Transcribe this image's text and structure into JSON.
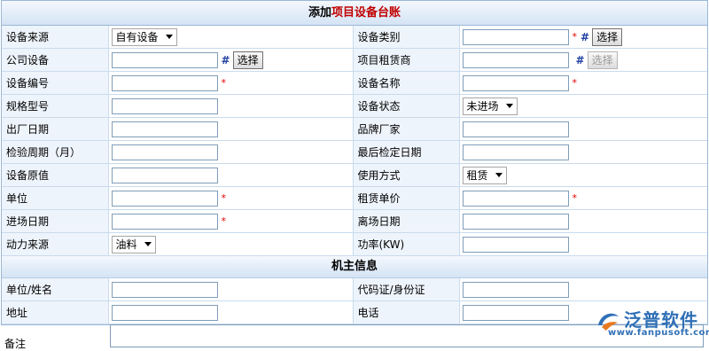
{
  "title": {
    "prefix": "添加",
    "highlight": "项目设备台账"
  },
  "rows": [
    {
      "l_label": "设备来源",
      "r_label": "设备类别"
    },
    {
      "l_label": "公司设备",
      "r_label": "项目租赁商"
    },
    {
      "l_label": "设备编号",
      "r_label": "设备名称"
    },
    {
      "l_label": "规格型号",
      "r_label": "设备状态"
    },
    {
      "l_label": "出厂日期",
      "r_label": "品牌厂家"
    },
    {
      "l_label": "检验周期（月）",
      "r_label": "最后检定日期"
    },
    {
      "l_label": "设备原值",
      "r_label": "使用方式"
    },
    {
      "l_label": "单位",
      "r_label": "租赁单价"
    },
    {
      "l_label": "进场日期",
      "r_label": "离场日期"
    },
    {
      "l_label": "动力来源",
      "r_label": "功率(KW)"
    }
  ],
  "selects": {
    "source": "自有设备",
    "status": "未进场",
    "usage": "租赁",
    "power": "油料"
  },
  "buttons": {
    "select": "选择"
  },
  "marks": {
    "required": "*",
    "hash": "#"
  },
  "owner_section": {
    "title": "机主信息",
    "rows": [
      {
        "l_label": "单位/姓名",
        "r_label": "代码证/身份证"
      },
      {
        "l_label": "地址",
        "r_label": "电话"
      }
    ]
  },
  "notes_label": "备注",
  "logo": {
    "name": "泛普软件",
    "url": "www.fanpusoft.com"
  },
  "colors": {
    "header_bg": "#d4e3f4",
    "label_bg": "#eef4fb",
    "required": "#e00000",
    "hash": "#1f3fa0",
    "brand": "#2f6fb6"
  }
}
